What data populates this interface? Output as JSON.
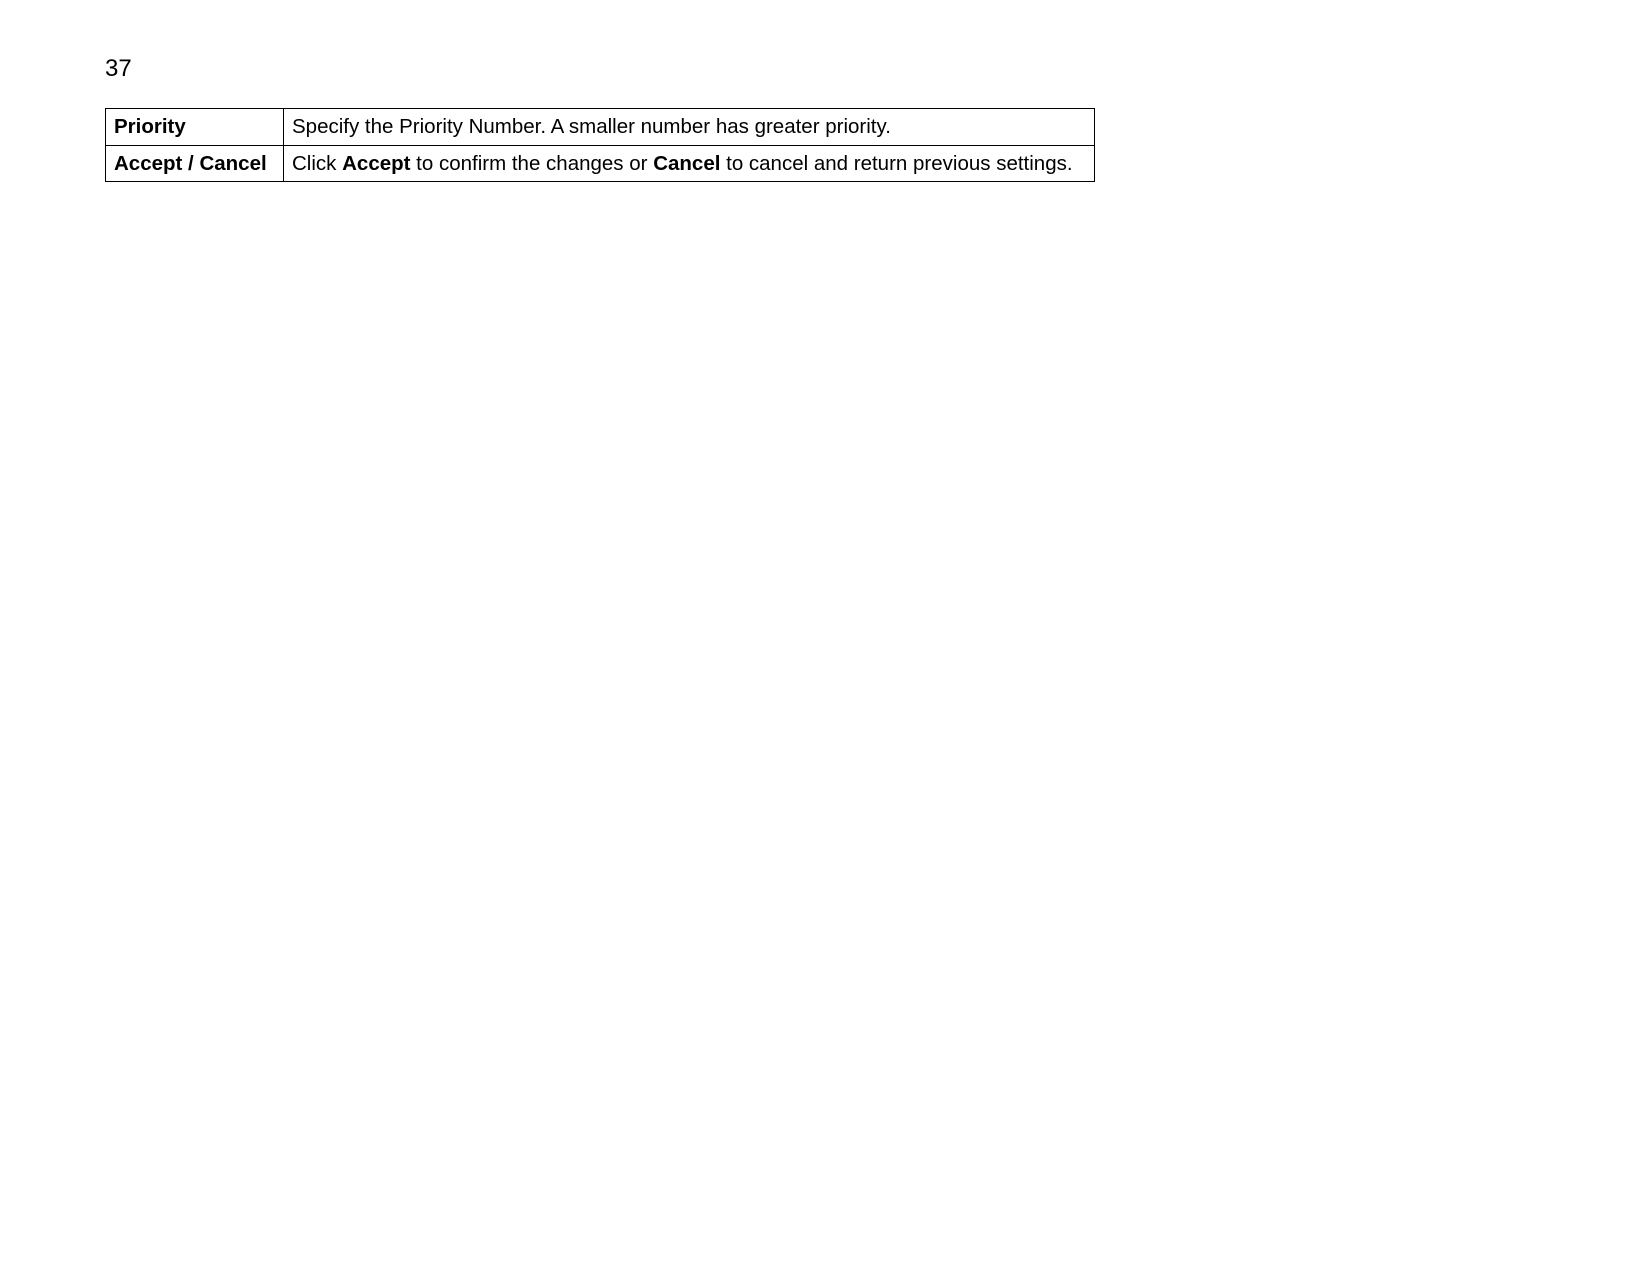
{
  "page_number": "37",
  "rows": [
    {
      "label": "Priority",
      "desc_parts": [
        "Specify the Priority Number. A smaller number has greater priority."
      ]
    },
    {
      "label": "Accept / Cancel",
      "desc_parts": [
        "Click ",
        {
          "bold": true,
          "text": "Accept"
        },
        " to confirm the changes or ",
        {
          "bold": true,
          "text": "Cancel"
        },
        " to cancel and return previous settings."
      ]
    }
  ]
}
